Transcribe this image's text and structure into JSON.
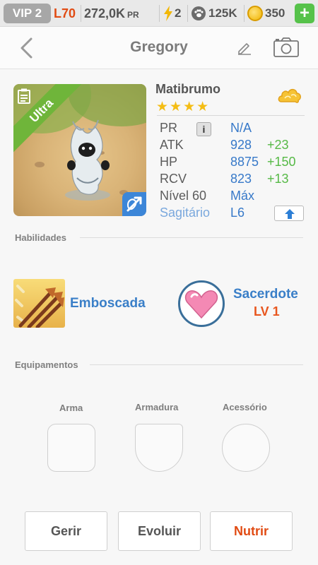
{
  "topbar": {
    "vip": "VIP 2",
    "level": "L70",
    "pr_value": "272,0K",
    "pr_unit": "PR",
    "energy": "2",
    "paw_count": "125K",
    "gold": "350",
    "add_label": "+"
  },
  "header": {
    "title": "Gregory"
  },
  "monster": {
    "rarity": "Ultra",
    "name": "Matibrumo",
    "stars": "★★★★",
    "element": "bow",
    "stats": {
      "pr_label": "PR",
      "pr_value": "N/A",
      "info_label": "i",
      "atk_label": "ATK",
      "atk_value": "928",
      "atk_bonus": "+23",
      "hp_label": "HP",
      "hp_value": "8875",
      "hp_bonus": "+150",
      "rcv_label": "RCV",
      "rcv_value": "823",
      "rcv_bonus": "+13",
      "level_label": "Nível 60",
      "level_value": "Máx",
      "constellation_label": "Sagitário",
      "constellation_value": "L6"
    }
  },
  "skills": {
    "section_title": "Habilidades",
    "active_name": "Emboscada",
    "leader_name": "Sacerdote",
    "leader_level": "LV 1"
  },
  "equipment": {
    "section_title": "Equipamentos",
    "weapon_label": "Arma",
    "armor_label": "Armadura",
    "accessory_label": "Acessório"
  },
  "actions": {
    "manage_label": "Gerir",
    "evolve_label": "Evoluir",
    "feed_label": "Nutrir"
  },
  "colors": {
    "accent_orange": "#e14b13",
    "stat_blue": "#3779c9",
    "bonus_green": "#56b946",
    "ultra_green": "#6fb53a",
    "star_yellow": "#f4bd14"
  }
}
